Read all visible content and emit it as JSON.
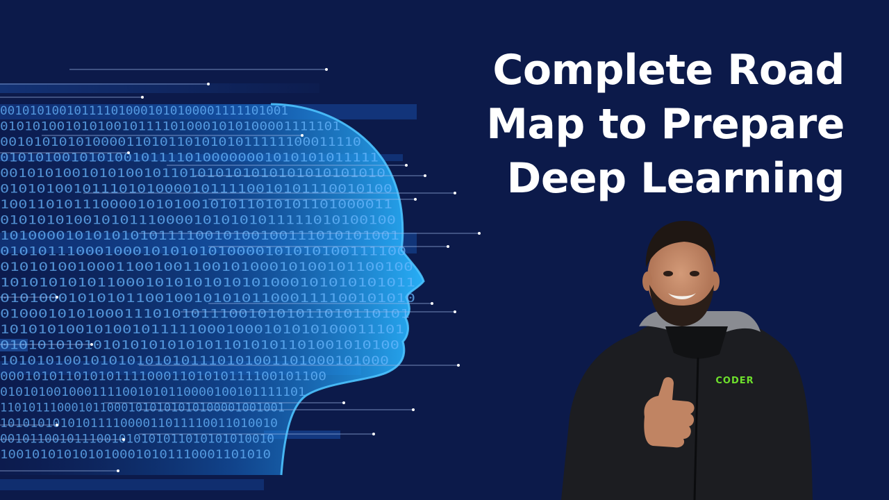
{
  "title": {
    "line1": "Complete Road",
    "line2": "Map to Prepare",
    "line3": "Deep Learning"
  },
  "shirt_logo": "CODER",
  "binary_rows": [
    "001010100101111010001010100001111101001",
    "010101001010100101111010001010100001111101",
    "0010101010100001101011010101011111100011110",
    "0101010010101001011110100000001010101011111",
    "0010101001010100101101010101010101010101010",
    "0101010010111010100001011110010101110010100",
    "1001101011100001010100101011010101101000011",
    "0101010100101011100001010101011111010100100",
    "1010000101010101011110010100100111010101001",
    "0101011100010001010101010000101010100111100",
    "0101010010001100100110010100010100101100100",
    "1010101010110001010101010101000101010101011",
    "0101000101010110010010101011000111100101010",
    "0100010101000111010101110010101011010110101",
    "1010101001010010111110001000101010100011101",
    "0101010101010101010101011010101101001010100",
    "1010101001010101010101110101001101000101000",
    "0001010110101011110001101010111100101100",
    "0101010010001111001010110000100101111101",
    "1101011100010110001010101010100001001001",
    "1010101010101111000011011110011010010",
    "0010110010111001010101011010101010010",
    "1001010101010100010101110001101010"
  ],
  "colors": {
    "background": "#0c1a4a",
    "glow": "#1fa3ff",
    "digits": "#6ab8ff",
    "hoodie": "#1c1d21",
    "logo_green": "#6ee02c"
  }
}
